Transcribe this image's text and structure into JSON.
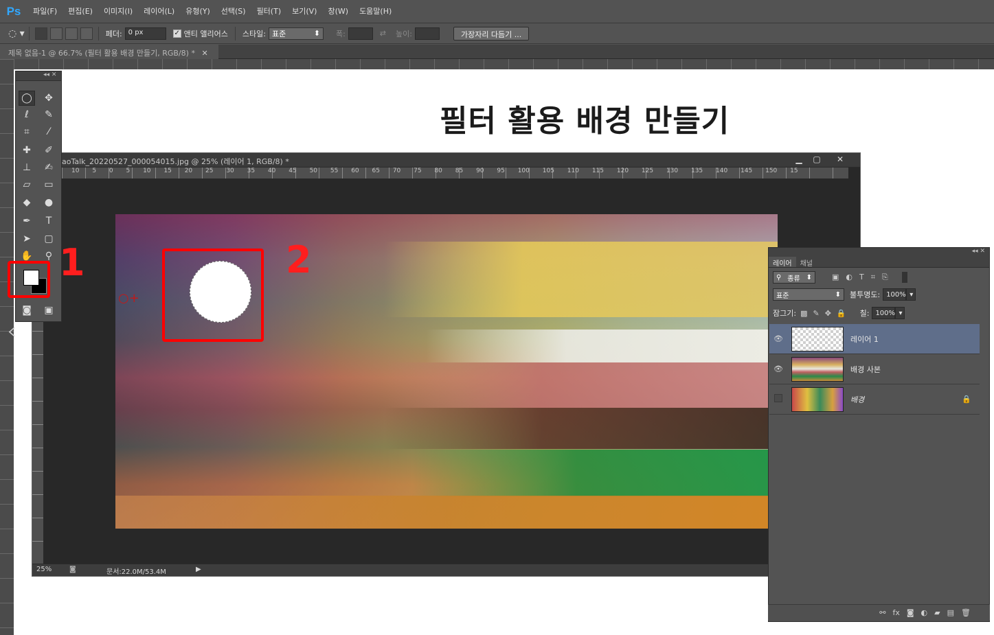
{
  "app": {
    "logo": "Ps"
  },
  "menu": [
    "파일(F)",
    "편집(E)",
    "이미지(I)",
    "레이어(L)",
    "유형(Y)",
    "선택(S)",
    "필터(T)",
    "보기(V)",
    "창(W)",
    "도움말(H)"
  ],
  "options": {
    "feather_label": "페더:",
    "feather_value": "0 px",
    "antialias_label": "앤티 앨리어스",
    "style_label": "스타일:",
    "style_value": "표준",
    "width_label": "폭:",
    "height_label": "높이:",
    "refine_button": "가장자리 다듬기 ..."
  },
  "outer_tab": {
    "label": "제목 없음-1 @ 66.7% (필터 활용 배경 만들기, RGB/8) *"
  },
  "outer_canvas": {
    "title": "필터 활용 배경 만들기"
  },
  "doc": {
    "title": "aoTalk_20220527_000054015.jpg @ 25% (레이어 1, RGB/8) *",
    "ruler_ticks": [
      "10",
      "5",
      "0",
      "5",
      "10",
      "15",
      "20",
      "25",
      "30",
      "35",
      "40",
      "45",
      "50",
      "55",
      "60",
      "65",
      "70",
      "75",
      "80",
      "85",
      "90",
      "95",
      "100",
      "105",
      "110",
      "115",
      "120",
      "125",
      "130",
      "135",
      "140",
      "145",
      "150",
      "15"
    ],
    "zoom": "25%",
    "status": "문서:22.0M/53.4M"
  },
  "annotations": {
    "label1": "1",
    "label2": "2"
  },
  "colors": {
    "foreground": "#ffffff",
    "background": "#000000",
    "annotation_red": "#ff0000"
  },
  "layers_panel": {
    "tabs": [
      "레이어",
      "채널"
    ],
    "filter_label": "종류",
    "blend_mode": "표준",
    "opacity_label": "불투명도:",
    "opacity_value": "100%",
    "lock_label": "잠그기:",
    "fill_label": "칠:",
    "fill_value": "100%",
    "layers": [
      {
        "name": "레이어 1",
        "visible": true,
        "selected": true
      },
      {
        "name": "배경 사본",
        "visible": true,
        "selected": false
      },
      {
        "name": "배경",
        "visible": false,
        "selected": false,
        "locked": true
      }
    ]
  }
}
